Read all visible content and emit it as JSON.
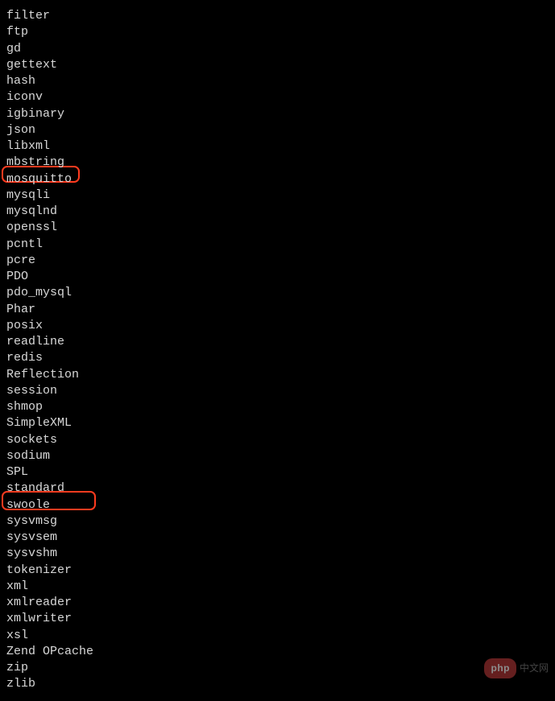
{
  "modules": [
    "filter",
    "ftp",
    "gd",
    "gettext",
    "hash",
    "iconv",
    "igbinary",
    "json",
    "libxml",
    "mbstring",
    "mosquitto",
    "mysqli",
    "mysqlnd",
    "openssl",
    "pcntl",
    "pcre",
    "PDO",
    "pdo_mysql",
    "Phar",
    "posix",
    "readline",
    "redis",
    "Reflection",
    "session",
    "shmop",
    "SimpleXML",
    "sockets",
    "sodium",
    "SPL",
    "standard",
    "swoole",
    "sysvmsg",
    "sysvsem",
    "sysvshm",
    "tokenizer",
    "xml",
    "xmlreader",
    "xmlwriter",
    "xsl",
    "Zend OPcache",
    "zip",
    "zlib"
  ],
  "highlights": {
    "first": "mosquitto",
    "second": "swoole"
  },
  "watermark": {
    "badge": "php",
    "text": "中文网"
  }
}
